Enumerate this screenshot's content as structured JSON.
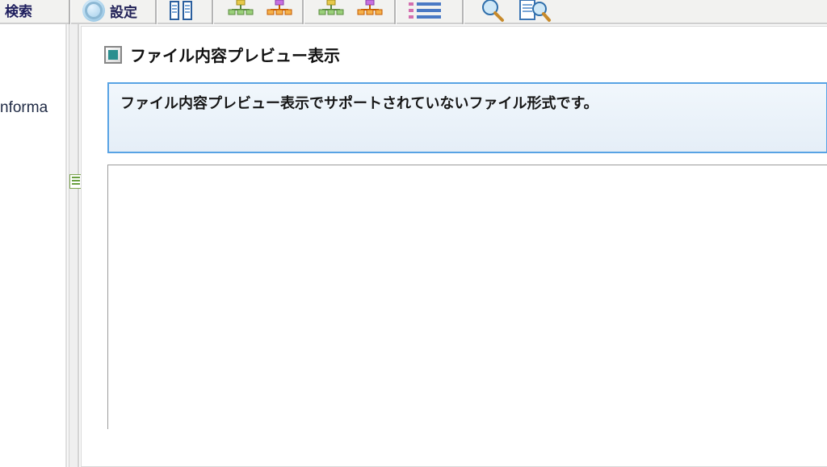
{
  "toolbar": {
    "left_label_fragment": "検索",
    "settings_label": "設定"
  },
  "sidebar": {
    "node_fragment": "nforma"
  },
  "panel": {
    "title": "ファイル内容プレビュー表示",
    "message": "ファイル内容プレビュー表示でサポートされていないファイル形式です。"
  }
}
